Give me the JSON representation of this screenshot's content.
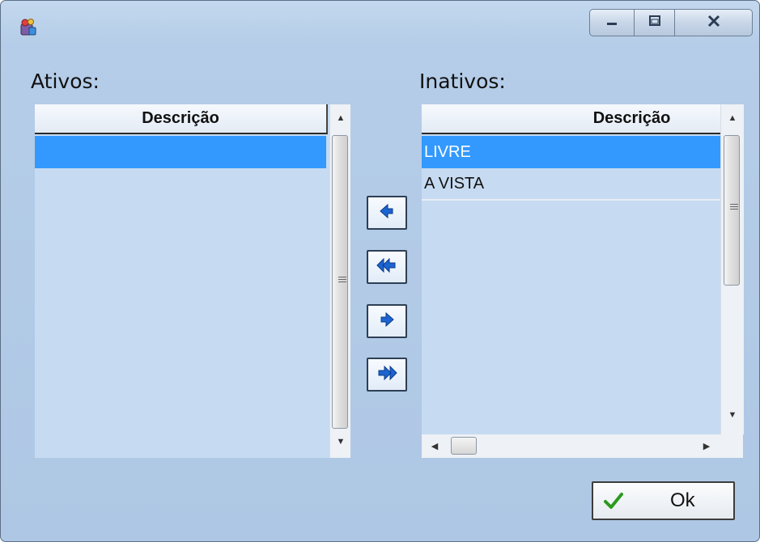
{
  "window": {
    "app_icon": "paint-app-icon",
    "controls": {
      "minimize": "minimize-icon",
      "maximize": "maximize-icon",
      "close": "close-icon"
    }
  },
  "ativos": {
    "label": "Ativos:",
    "column_header": "Descrição",
    "rows": [
      ""
    ]
  },
  "inativos": {
    "label": "Inativos:",
    "column_header": "Descrição",
    "rows": [
      "LIVRE",
      "A VISTA"
    ]
  },
  "transfer_buttons": [
    {
      "name": "move-left-button",
      "icon": "arrow-left-icon"
    },
    {
      "name": "move-all-left-button",
      "icon": "double-arrow-left-icon"
    },
    {
      "name": "move-right-button",
      "icon": "arrow-right-icon"
    },
    {
      "name": "move-all-right-button",
      "icon": "double-arrow-right-icon"
    }
  ],
  "ok_button": {
    "label": "Ok",
    "icon": "checkmark-icon"
  },
  "colors": {
    "selection": "#3399ff",
    "panel": "#c6dbf1",
    "arrow_blue": "#1b64d1",
    "check_green": "#2a9a1f"
  }
}
